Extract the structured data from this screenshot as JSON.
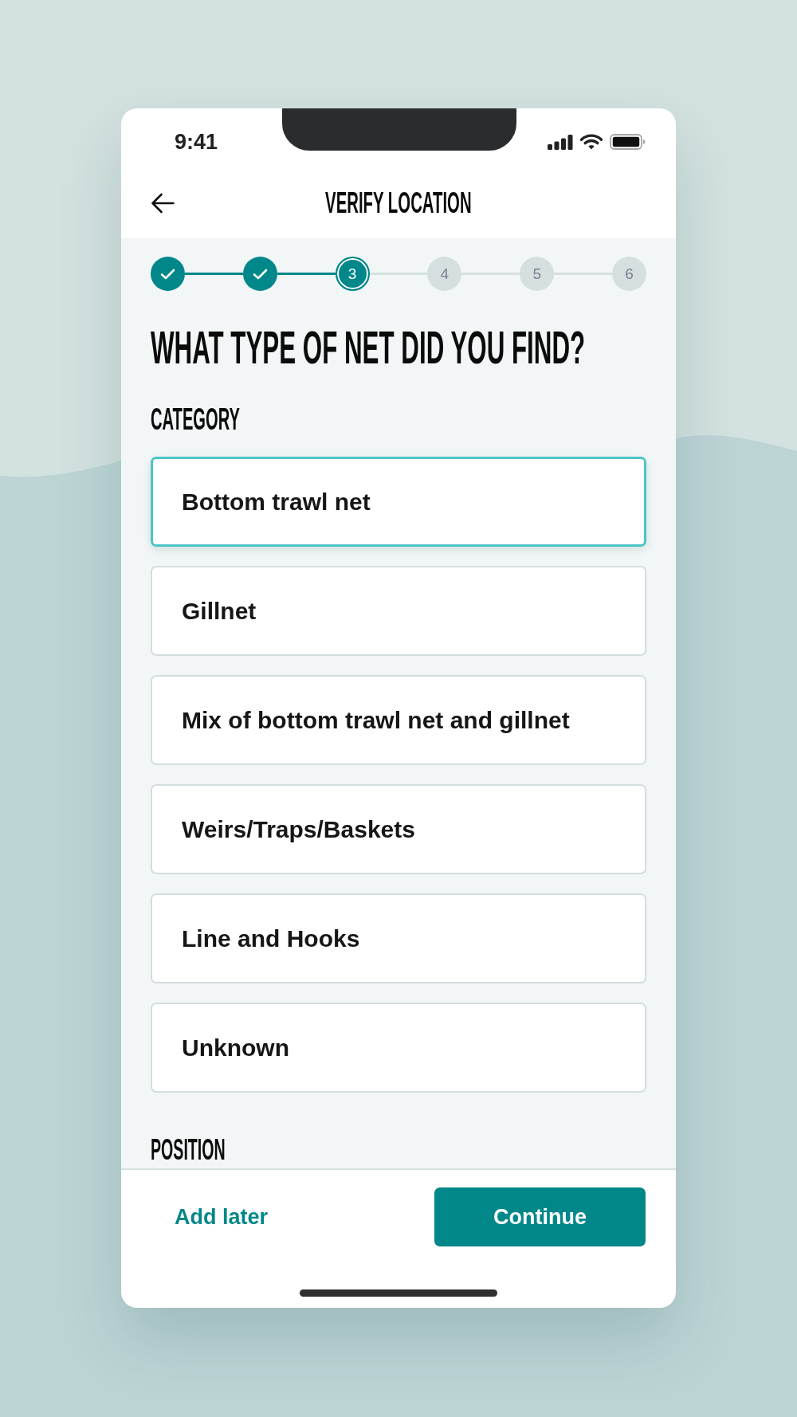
{
  "status_bar": {
    "time": "9:41"
  },
  "header": {
    "title": "VERIFY LOCATION"
  },
  "steps": [
    {
      "completed": true,
      "selected": false
    },
    {
      "completed": true,
      "selected": false
    },
    {
      "label": "3",
      "completed": false,
      "selected": true
    },
    {
      "label": "4",
      "completed": false,
      "selected": false
    },
    {
      "label": "5",
      "completed": false,
      "selected": false
    },
    {
      "label": "6",
      "completed": false,
      "selected": false
    }
  ],
  "question": "WHAT TYPE OF NET DID YOU FIND?",
  "category": {
    "heading": "CATEGORY",
    "options": [
      {
        "label": "Bottom trawl net",
        "selected": true
      },
      {
        "label": "Gillnet",
        "selected": false
      },
      {
        "label": "Mix of bottom trawl net and gillnet",
        "selected": false
      },
      {
        "label": "Weirs/Traps/Baskets",
        "selected": false
      },
      {
        "label": "Line and Hooks",
        "selected": false
      },
      {
        "label": "Unknown",
        "selected": false
      }
    ]
  },
  "position": {
    "heading": "POSITION"
  },
  "footer": {
    "secondary_action": "Add later",
    "primary_action": "Continue"
  }
}
